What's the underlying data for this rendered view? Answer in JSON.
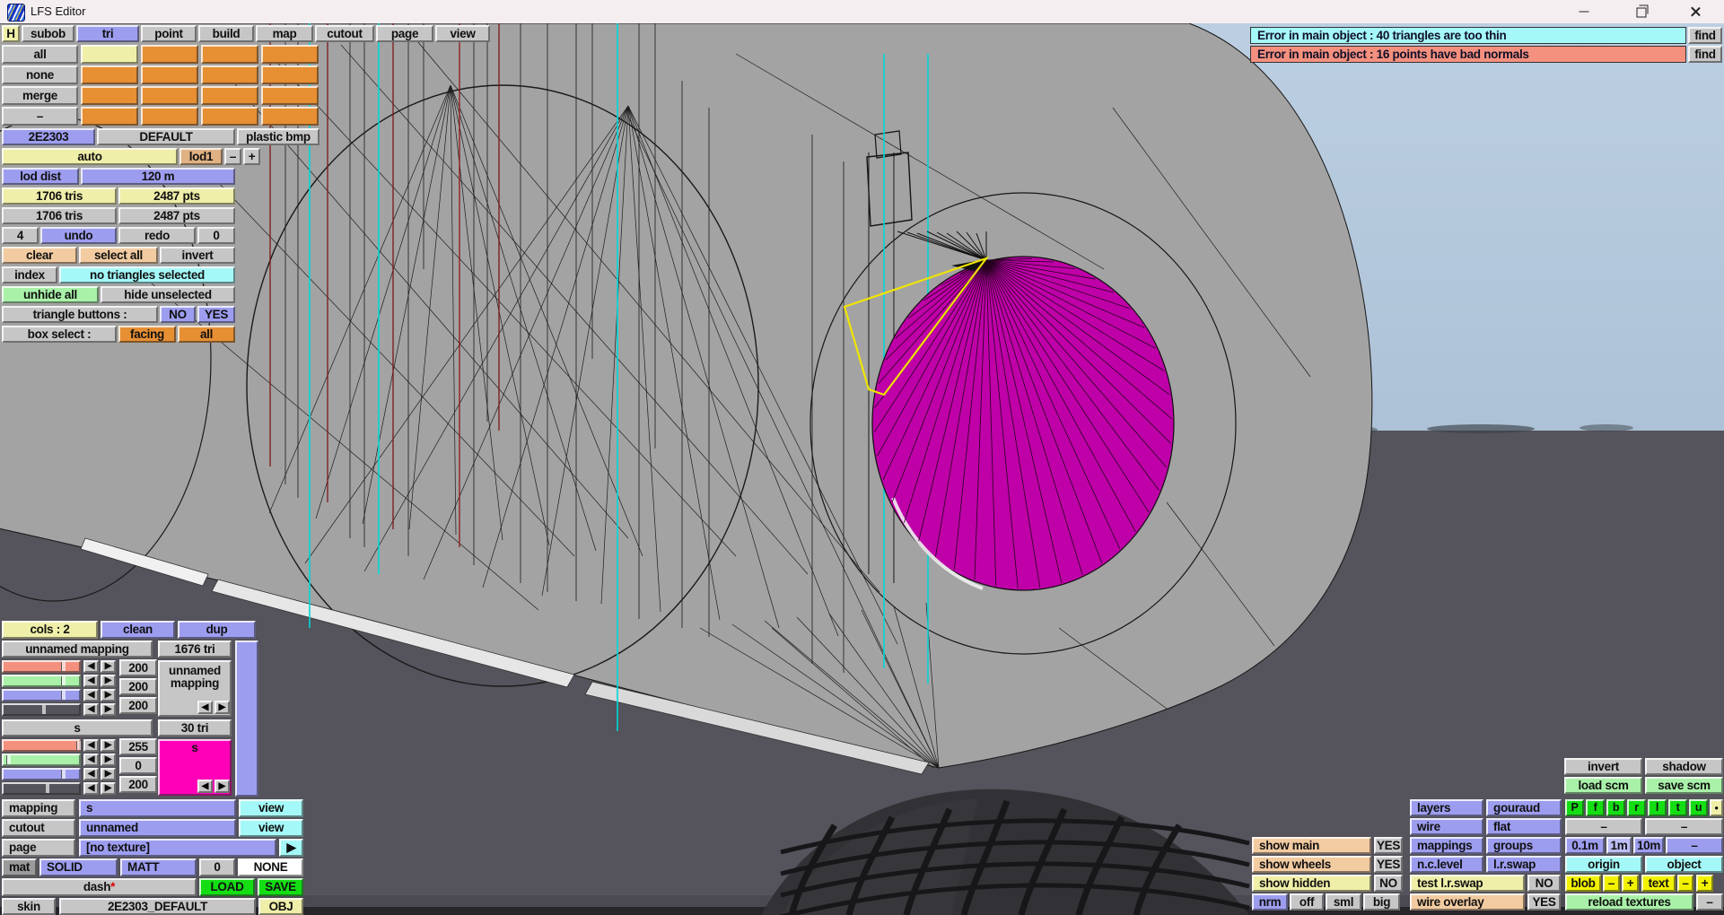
{
  "window": {
    "title": "LFS Editor"
  },
  "menu": {
    "items": [
      "H",
      "subob",
      "tri",
      "point",
      "build",
      "map",
      "cutout",
      "page",
      "view"
    ],
    "active": "tri"
  },
  "subob_panel": {
    "rows": [
      "all",
      "none",
      "merge",
      "–"
    ]
  },
  "errors": [
    {
      "text": "Error in main object : 40 triangles are too thin",
      "action": "find"
    },
    {
      "text": "Error in main object : 16 points have bad normals",
      "action": "find"
    }
  ],
  "left_panel": {
    "obj_row": [
      "2E2303",
      "DEFAULT",
      "plastic bmp"
    ],
    "auto_row": {
      "auto": "auto",
      "lod": "lod1",
      "minus": "–",
      "plus": "+"
    },
    "lod_dist": {
      "label": "lod dist",
      "value": "120 m"
    },
    "counts_current": {
      "tris": "1706 tris",
      "pts": "2487 pts"
    },
    "counts_total": {
      "tris": "1706 tris",
      "pts": "2487 pts"
    },
    "undo_row": {
      "undo_count": "4",
      "undo": "undo",
      "redo": "redo",
      "redo_count": "0"
    },
    "select_row": [
      "clear",
      "select all",
      "invert"
    ],
    "index_row": {
      "index": "index",
      "status": "no triangles selected"
    },
    "hide_row": [
      "unhide all",
      "hide unselected"
    ],
    "triangle_buttons": {
      "label": "triangle buttons :",
      "no": "NO",
      "yes": "YES"
    },
    "box_select": {
      "label": "box select :",
      "facing": "facing",
      "all": "all"
    }
  },
  "color_panel": {
    "header": {
      "cols": "cols : 2",
      "clean": "clean",
      "dup": "dup"
    },
    "blocks": [
      {
        "name": "unnamed mapping",
        "tri_count": "1676 tri",
        "values": [
          "200",
          "200",
          "200"
        ],
        "right_line1": "unnamed",
        "right_line2": "mapping"
      },
      {
        "name": "s",
        "tri_count": "30 tri",
        "values": [
          "255",
          "0",
          "200"
        ],
        "swatch_label": "s"
      }
    ],
    "arrows": {
      "left": "◀",
      "right": "▶"
    }
  },
  "bottom_left": {
    "mapping_row": {
      "label": "mapping",
      "value": "s",
      "view": "view"
    },
    "cutout_row": {
      "label": "cutout",
      "value": "unnamed",
      "view": "view"
    },
    "page_row": {
      "label": "page",
      "value": "[no texture]",
      "arrow": "▶"
    },
    "mat_row": {
      "label": "mat",
      "solid": "SOLID",
      "matt": "MATT",
      "zero": "0",
      "none": "NONE"
    },
    "dash_row": {
      "label": "dash",
      "star": "*",
      "load": "LOAD",
      "save": "SAVE"
    },
    "skin_row": {
      "label": "skin",
      "value": "2E2303_DEFAULT",
      "obj": "OBJ"
    }
  },
  "right_panel": {
    "invert": "invert",
    "shadow": "shadow",
    "load_scm": "load scm",
    "save_scm": "save scm",
    "layers": "layers",
    "gouraud": "gouraud",
    "layer_buttons": [
      "P",
      "f",
      "b",
      "r",
      "l",
      "t",
      "u"
    ],
    "layer_dot": "●",
    "wire": "wire",
    "flat": "flat",
    "wire_dash1": "–",
    "wire_dash2": "–",
    "show_main": "show main",
    "show_main_val": "YES",
    "mappings": "mappings",
    "groups": "groups",
    "grid_01m": "0.1m",
    "grid_1m": "1m",
    "grid_10m": "10m",
    "grid_dash": "–",
    "show_wheels": "show wheels",
    "show_wheels_val": "YES",
    "nclevel": "n.c.level",
    "lrswap": "l.r.swap",
    "origin": "origin",
    "object": "object",
    "show_hidden": "show hidden",
    "show_hidden_val": "NO",
    "test_lrswap": "test l.r.swap",
    "test_lrswap_val": "NO",
    "blob": "blob",
    "blob_minus": "–",
    "blob_plus": "+",
    "text_btn": "text",
    "text_minus": "–",
    "text_plus": "+",
    "nrm": "nrm",
    "off": "off",
    "sml": "sml",
    "big": "big",
    "wire_overlay": "wire overlay",
    "wire_overlay_val": "YES",
    "reload_textures": "reload textures",
    "reload_dash": "–"
  },
  "colors": {
    "accent_periwinkle": "#9d9df0",
    "accent_orange": "#e78f33",
    "accent_yellow": "#efefa9",
    "accent_cyan": "#a5f8f8",
    "accent_green": "#14dd14",
    "selection_magenta": "#bf00a8",
    "sky": "#b5c9dd",
    "ground": "#55535b"
  }
}
